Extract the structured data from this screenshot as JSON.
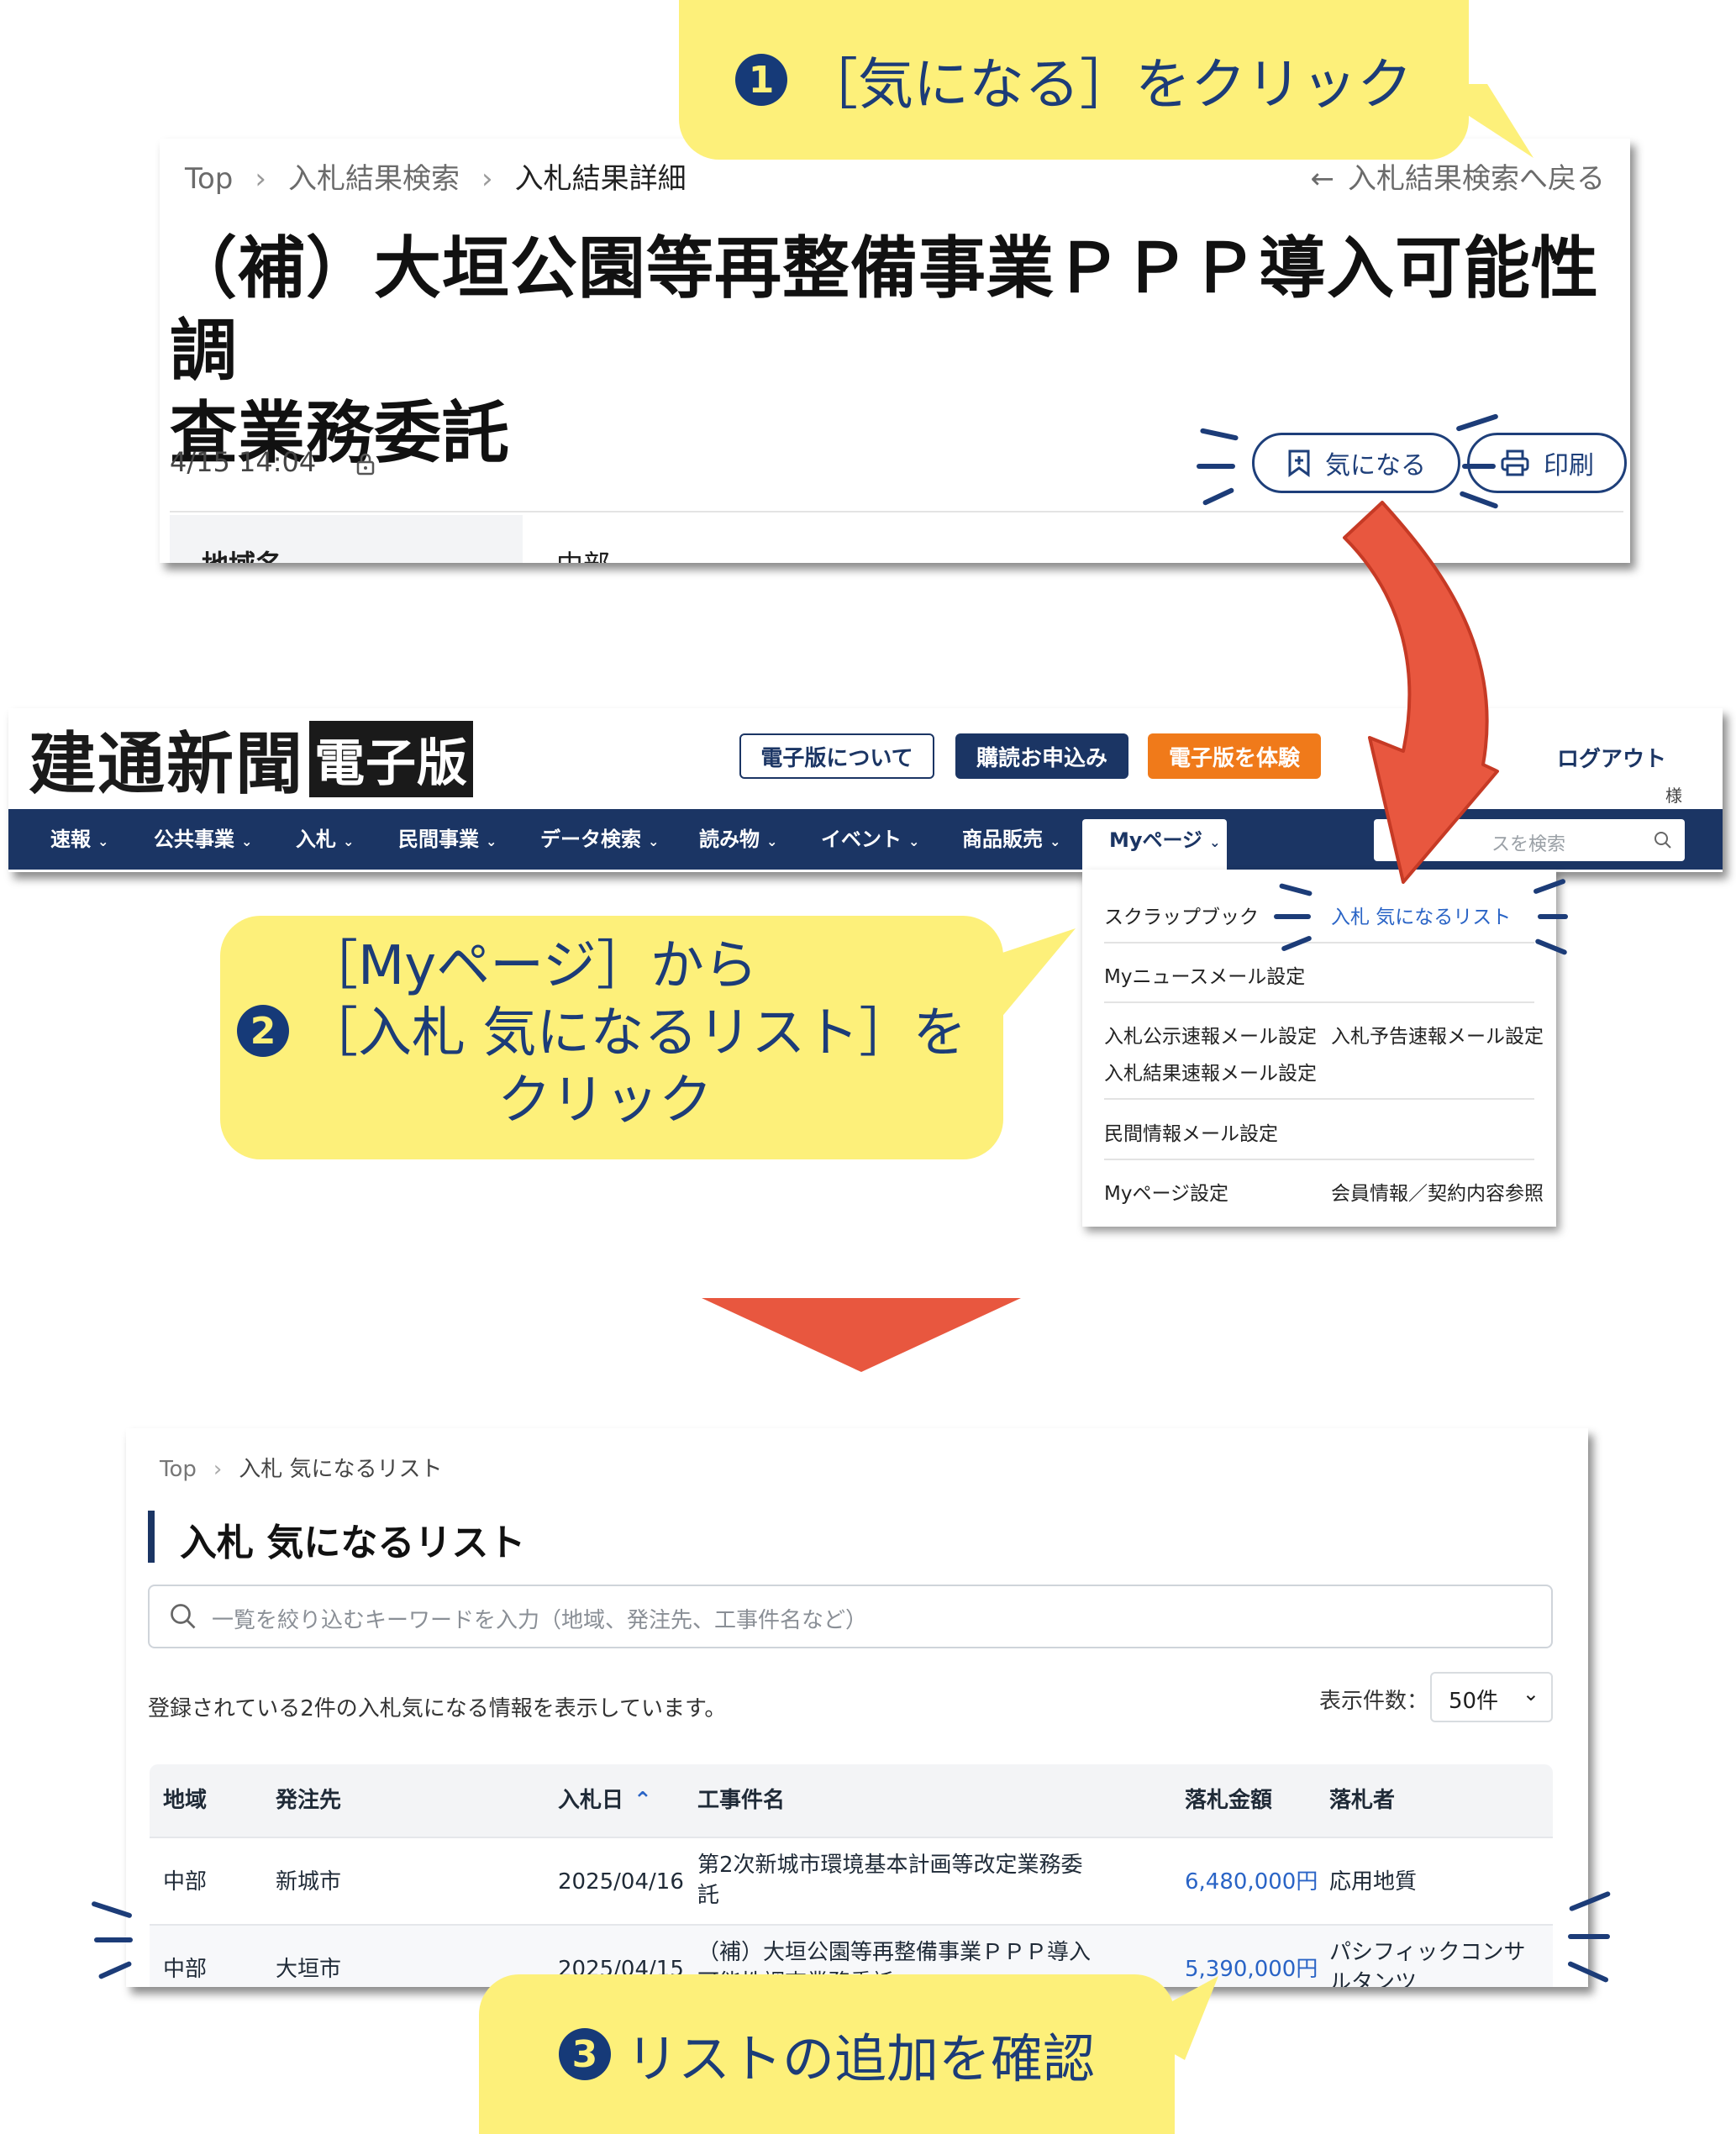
{
  "step1": {
    "number": "1",
    "text": "［気になる］をクリック"
  },
  "detail": {
    "breadcrumb": [
      "Top",
      "入札結果検索",
      "入札結果詳細"
    ],
    "back_link": "入札結果検索へ戻る",
    "title_line1": "（補）大垣公園等再整備事業ＰＰＰ導入可能性調",
    "title_line2": "査業務委託",
    "datetime": "4/15 14:04",
    "favorite_label": "気になる",
    "print_label": "印刷",
    "table_label": "地域名",
    "table_value": "中部"
  },
  "site": {
    "logo_main": "建通新聞",
    "logo_sub": "電子版",
    "btn_about": "電子版について",
    "btn_subscribe": "購読お申込み",
    "btn_trial": "電子版を体験",
    "logout": "ログアウト",
    "user_suffix": "様",
    "nav": [
      "速報",
      "公共事業",
      "入札",
      "民間事業",
      "データ検索",
      "読み物",
      "イベント",
      "商品販売",
      "Myページ"
    ],
    "search_placeholder": "スを検索",
    "colors": {
      "navy": "#1b3564",
      "trial": "#f07a1a",
      "link": "#2a64c6"
    }
  },
  "mypage_menu": {
    "scrapbook": "スクラップブック",
    "favorites": "入札 気になるリスト",
    "news_mail": "Myニュースメール設定",
    "public_mail": "入札公示速報メール設定",
    "forecast_mail": "入札予告速報メール設定",
    "result_mail": "入札結果速報メール設定",
    "private_mail": "民間情報メール設定",
    "mypage_settings": "Myページ設定",
    "member_info": "会員情報／契約内容参照"
  },
  "step2": {
    "number": "2",
    "line1": "［Myページ］から",
    "line2": "［入札 気になるリスト］を",
    "line3": "クリック"
  },
  "list": {
    "breadcrumb": [
      "Top",
      "入札 気になるリスト"
    ],
    "heading": "入札 気になるリスト",
    "search_placeholder": "一覧を絞り込むキーワードを入力（地域、発注先、工事件名など）",
    "summary": "登録されている2件の入札気になる情報を表示しています。",
    "per_page_label": "表示件数：",
    "per_page_value": "50件",
    "columns": [
      "地域",
      "発注先",
      "入札日",
      "工事件名",
      "落札金額",
      "落札者"
    ],
    "rows": [
      {
        "region": "中部",
        "client": "新城市",
        "date": "2025/04/16",
        "name1": "第2次新城市環境基本計画等改定業務委",
        "name2": "託",
        "amount": "6,480,000円",
        "winner1": "応用地質",
        "winner2": ""
      },
      {
        "region": "中部",
        "client": "大垣市",
        "date": "2025/04/15",
        "name1": "（補）大垣公園等再整備事業ＰＰＰ導入",
        "name2": "可能性調査業務委託",
        "amount": "5,390,000円",
        "winner1": "パシフィックコンサ",
        "winner2": "ルタンツ"
      }
    ]
  },
  "step3": {
    "number": "3",
    "text": "リストの追加を確認"
  }
}
